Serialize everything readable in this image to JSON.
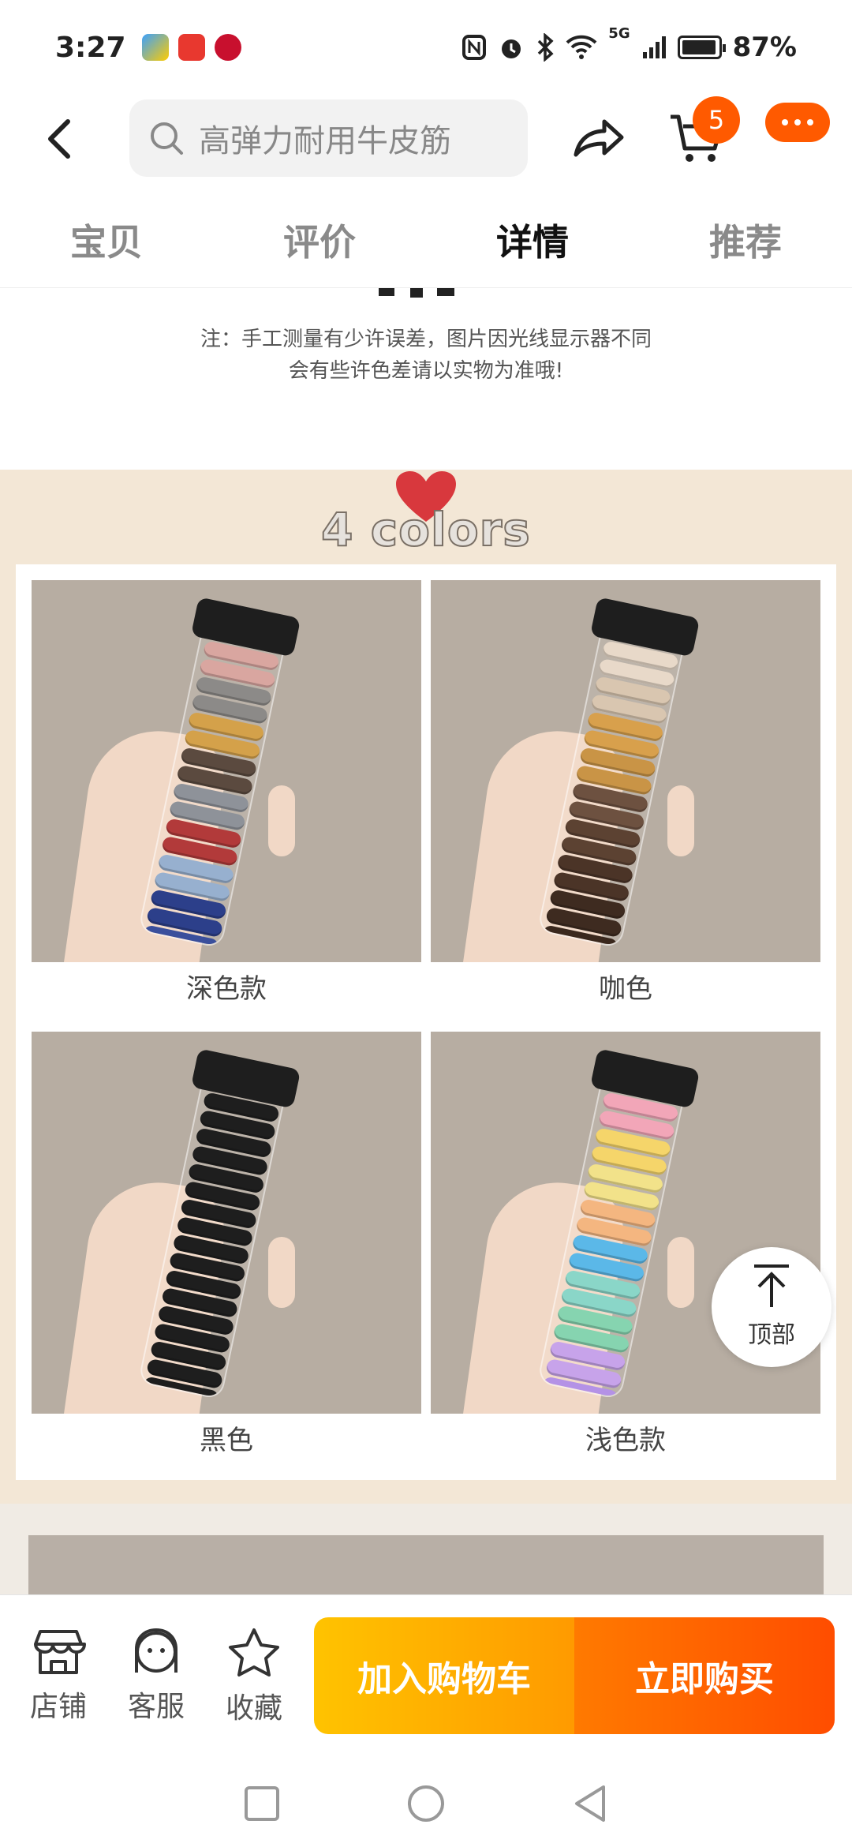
{
  "status_bar": {
    "time": "3:27",
    "network": "5G",
    "battery": "87%"
  },
  "header": {
    "search_placeholder": "高弹力耐用牛皮筋",
    "cart_count": "5"
  },
  "tabs": [
    {
      "label": "宝贝",
      "active": false
    },
    {
      "label": "评价",
      "active": false
    },
    {
      "label": "详情",
      "active": true
    },
    {
      "label": "推荐",
      "active": false
    }
  ],
  "note": {
    "line1": "注：手工测量有少许误差，图片因光线显示器不同",
    "line2": "会有些许色差请以实物为准哦!"
  },
  "colors_section": {
    "title": "4 colors",
    "variants": [
      {
        "label": "深色款",
        "rings": [
          "#d9a6a0",
          "#8c8a88",
          "#d4a14a",
          "#5b4a3f",
          "#8e9299",
          "#b23a3a",
          "#97b0cf",
          "#2c3f8a",
          "#3a4f9c"
        ]
      },
      {
        "label": "咖色",
        "rings": [
          "#e8d9c9",
          "#d9c6b0",
          "#d8a04c",
          "#c99446",
          "#6d5140",
          "#5c4232",
          "#4b3427",
          "#3e2b20",
          "#3a281d"
        ]
      },
      {
        "label": "黑色",
        "rings": [
          "#1e1e1e",
          "#1e1e1e",
          "#1e1e1e",
          "#1e1e1e",
          "#1e1e1e",
          "#1e1e1e",
          "#1e1e1e",
          "#1e1e1e",
          "#1e1e1e"
        ]
      },
      {
        "label": "浅色款",
        "rings": [
          "#f2a6b8",
          "#f5d56a",
          "#f2e28a",
          "#f4b680",
          "#5bb8e8",
          "#8ad6c8",
          "#86d4b0",
          "#c7a3ea",
          "#b492e6"
        ]
      }
    ]
  },
  "scroll_top": {
    "label": "顶部"
  },
  "action_bar": {
    "shop": "店铺",
    "service": "客服",
    "favorite": "收藏",
    "add_to_cart": "加入购物车",
    "buy_now": "立即购买"
  },
  "colors": {
    "accent": "#ff5a00",
    "cart_button": "#ffb000",
    "buy_button": "#ff5e00",
    "section_bg": "#f3e7d6"
  }
}
